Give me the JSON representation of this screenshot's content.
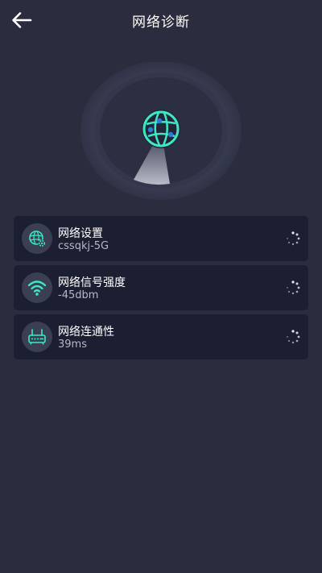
{
  "header": {
    "title": "网络诊断",
    "back_icon": "arrow-left-icon"
  },
  "scanner": {
    "icon": "network-globe-icon"
  },
  "items": [
    {
      "title": "网络设置",
      "value": "cssqkj-5G",
      "icon": "globe-gear-icon",
      "status_icon": "loading-spinner-icon"
    },
    {
      "title": "网络信号强度",
      "value": "-45dbm",
      "icon": "wifi-icon",
      "status_icon": "loading-spinner-icon"
    },
    {
      "title": "网络连通性",
      "value": "39ms",
      "icon": "router-icon",
      "status_icon": "loading-spinner-icon"
    }
  ],
  "colors": {
    "background": "#2b2d3e",
    "card": "#1c1f31",
    "accent": "#3ee8c4"
  }
}
